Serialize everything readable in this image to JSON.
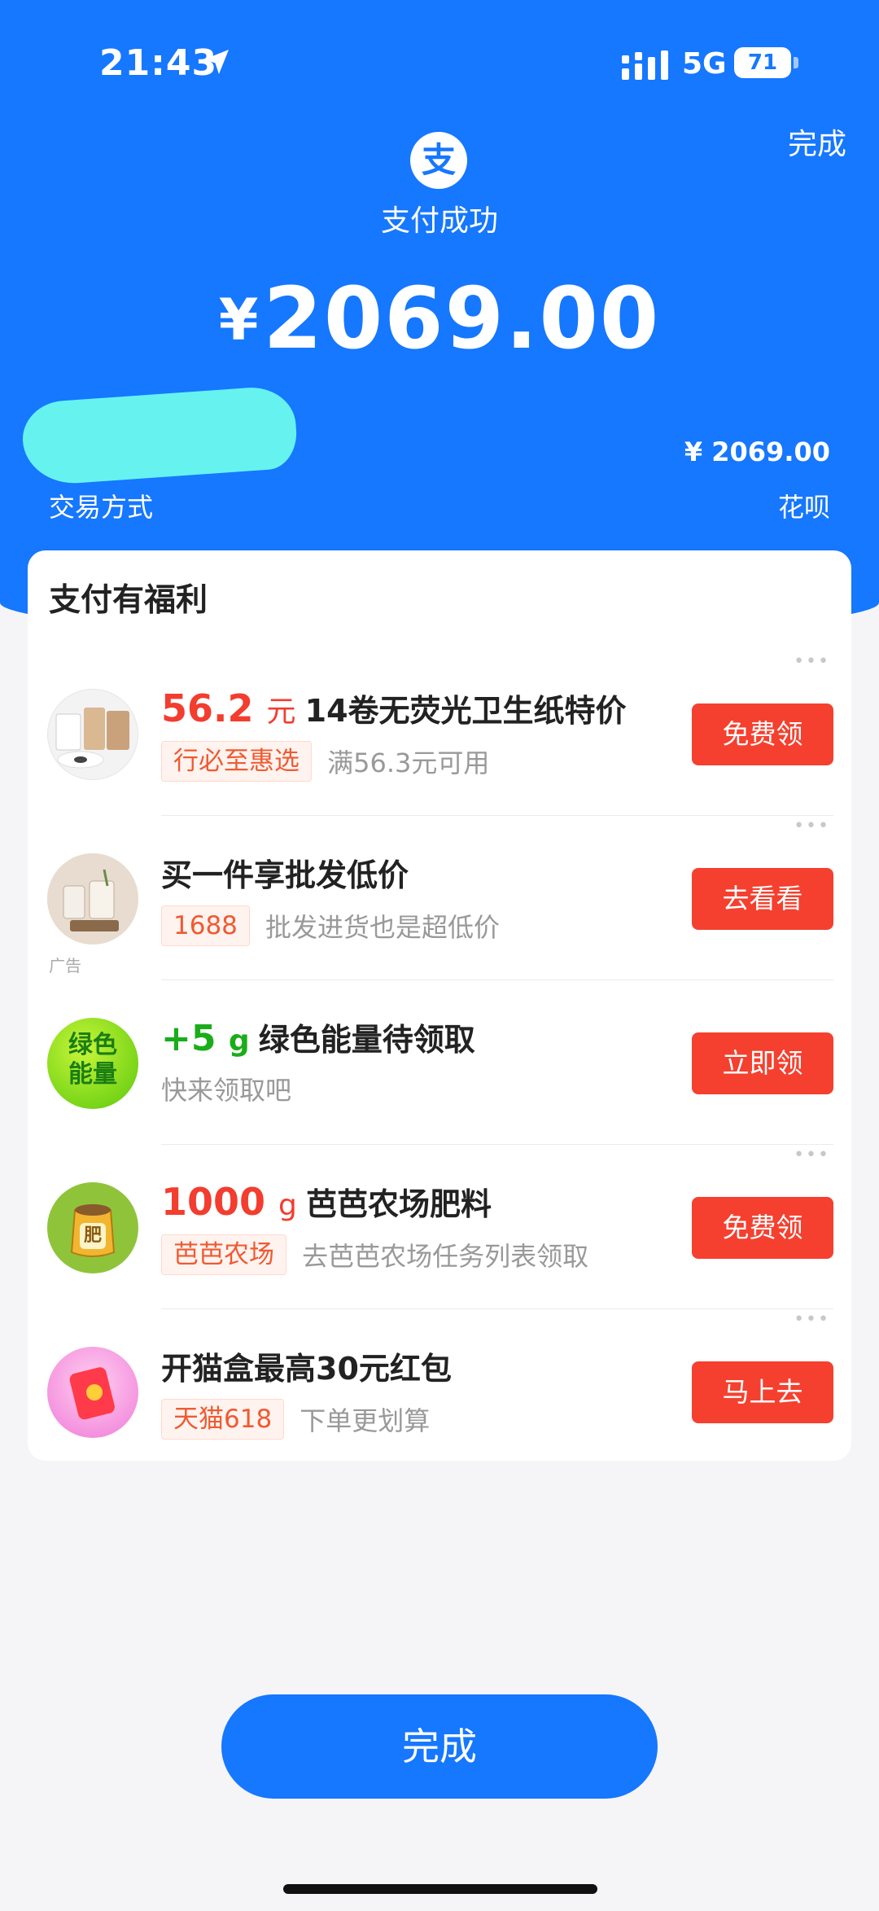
{
  "status_bar": {
    "time": "21:43",
    "network": "5G",
    "battery": "71"
  },
  "header": {
    "done_link": "完成",
    "logo_glyph": "支",
    "status_title": "支付成功",
    "currency_symbol": "¥",
    "amount": "2069.00",
    "detail_amount": "¥ 2069.00",
    "payment_method_label": "交易方式",
    "payment_method_value": "花呗"
  },
  "benefits": {
    "title": "支付有福利",
    "more_glyph": "•••",
    "items": [
      {
        "highlight": "56.2",
        "highlight_unit": "元",
        "title": "14卷无荧光卫生纸特价",
        "tag": "行必至惠选",
        "subtitle": "满56.3元可用",
        "button": "免费领"
      },
      {
        "title": "买一件享批发低价",
        "tag": "1688",
        "subtitle": "批发进货也是超低价",
        "button": "去看看",
        "ad_label": "广告"
      },
      {
        "highlight": "+5",
        "highlight_unit": "g",
        "title": "绿色能量待领取",
        "subtitle": "快来领取吧",
        "button": "立即领",
        "icon_text_1": "绿色",
        "icon_text_2": "能量"
      },
      {
        "highlight": "1000",
        "highlight_unit": "g",
        "title": "芭芭农场肥料",
        "tag": "芭芭农场",
        "subtitle": "去芭芭农场任务列表领取",
        "button": "免费领",
        "icon_text": "肥"
      },
      {
        "title": "开猫盒最高30元红包",
        "tag": "天猫618",
        "subtitle": "下单更划算",
        "button": "马上去"
      }
    ]
  },
  "footer": {
    "done_button": "完成"
  },
  "colors": {
    "brand_blue": "#1677ff",
    "action_red": "#f5402f",
    "highlight_red": "#f23d2f",
    "highlight_green": "#1aad19",
    "redaction_cyan": "#66f2ee"
  },
  "icons": [
    "location-arrow-icon",
    "signal-icon",
    "battery-icon",
    "alipay-logo-icon",
    "more-icon"
  ]
}
